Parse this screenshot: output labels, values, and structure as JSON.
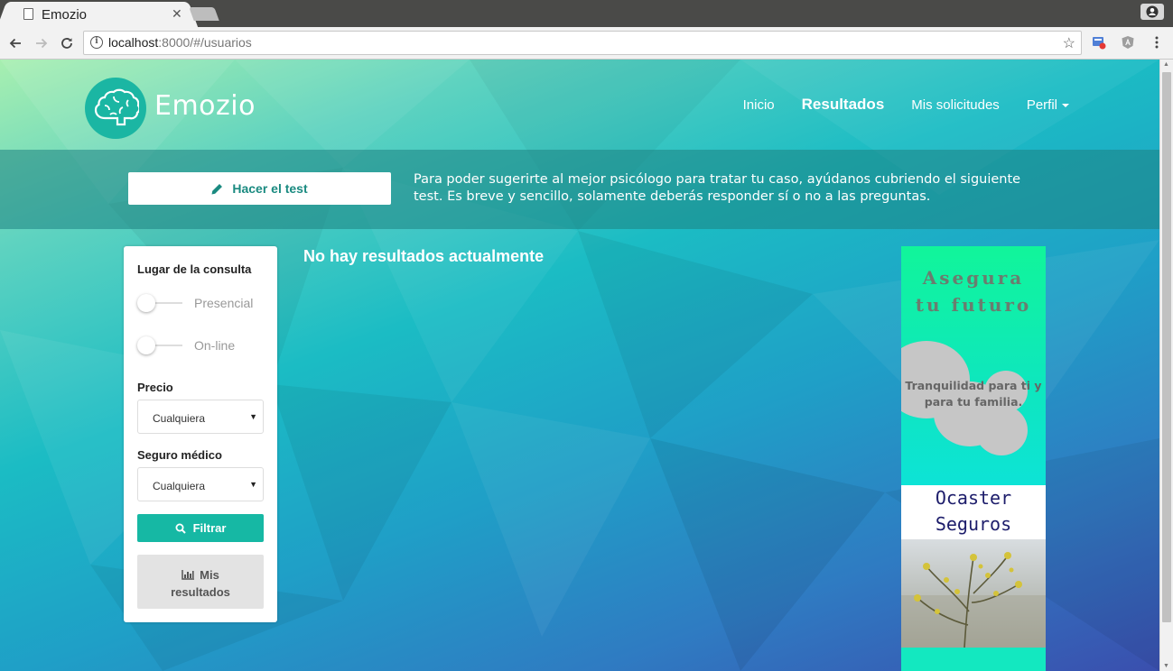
{
  "browser": {
    "tab_title": "Emozio",
    "url_host": "localhost",
    "url_rest": ":8000/#/usuarios"
  },
  "site": {
    "brand": "Emozio",
    "nav": {
      "inicio": "Inicio",
      "resultados": "Resultados",
      "solicitudes": "Mis solicitudes",
      "perfil": "Perfil"
    }
  },
  "banner": {
    "test_button": "Hacer el test",
    "text": "Para poder sugerirte al mejor psicólogo para tratar tu caso, ayúdanos cubriendo el siguiente test. Es breve y sencillo, solamente deberás responder sí o no a las preguntas."
  },
  "filters": {
    "location_heading": "Lugar de la consulta",
    "toggle_presencial": "Presencial",
    "toggle_online": "On-line",
    "price_heading": "Precio",
    "price_value": "Cualquiera",
    "insurance_heading": "Seguro médico",
    "insurance_value": "Cualquiera",
    "filter_button": "Filtrar",
    "results_button_line1": "Mis",
    "results_button_line2": "resultados"
  },
  "main": {
    "empty_message": "No hay resultados actualmente"
  },
  "ad": {
    "title_line1": "Asegura",
    "title_line2": "tu futuro",
    "tagline_line1": "Tranquilidad para ti y",
    "tagline_line2": "para tu familia.",
    "brand_line1": "Ocaster",
    "brand_line2": "Seguros"
  },
  "colors": {
    "accent": "#16b8a4",
    "ad_green": "#11f59a",
    "ad_brand": "#1d1d6b"
  }
}
